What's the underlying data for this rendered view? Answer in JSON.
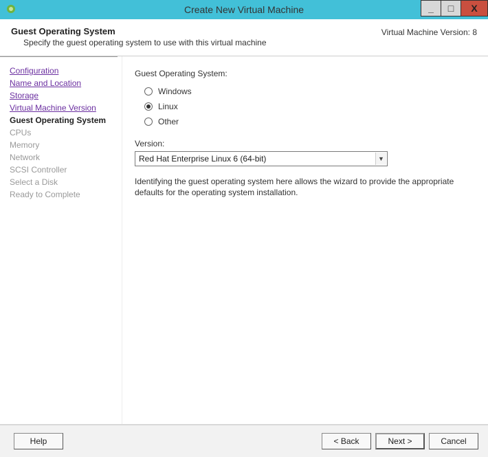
{
  "titlebar": {
    "title": "Create New Virtual Machine",
    "min": "_",
    "max": "□",
    "close": "X"
  },
  "header": {
    "title": "Guest Operating System",
    "subtitle": "Specify the guest operating system to use with this virtual machine",
    "version_info": "Virtual Machine Version: 8"
  },
  "sidebar": {
    "steps": [
      {
        "label": "Configuration",
        "state": "visited"
      },
      {
        "label": "Name and Location",
        "state": "visited"
      },
      {
        "label": "Storage",
        "state": "visited"
      },
      {
        "label": "Virtual Machine Version",
        "state": "visited"
      },
      {
        "label": "Guest Operating System",
        "state": "current"
      },
      {
        "label": "CPUs",
        "state": "future"
      },
      {
        "label": "Memory",
        "state": "future"
      },
      {
        "label": "Network",
        "state": "future"
      },
      {
        "label": "SCSI Controller",
        "state": "future"
      },
      {
        "label": "Select a Disk",
        "state": "future"
      },
      {
        "label": "Ready to Complete",
        "state": "future"
      }
    ]
  },
  "main": {
    "os_section_label": "Guest Operating System:",
    "radios": {
      "windows": "Windows",
      "linux": "Linux",
      "other": "Other",
      "selected": "linux"
    },
    "version_label": "Version:",
    "version_value": "Red Hat Enterprise Linux 6 (64-bit)",
    "hint": "Identifying the guest operating system here allows the wizard to provide the appropriate defaults for the operating system installation."
  },
  "footer": {
    "help": "Help",
    "back": "< Back",
    "next": "Next >",
    "cancel": "Cancel"
  }
}
